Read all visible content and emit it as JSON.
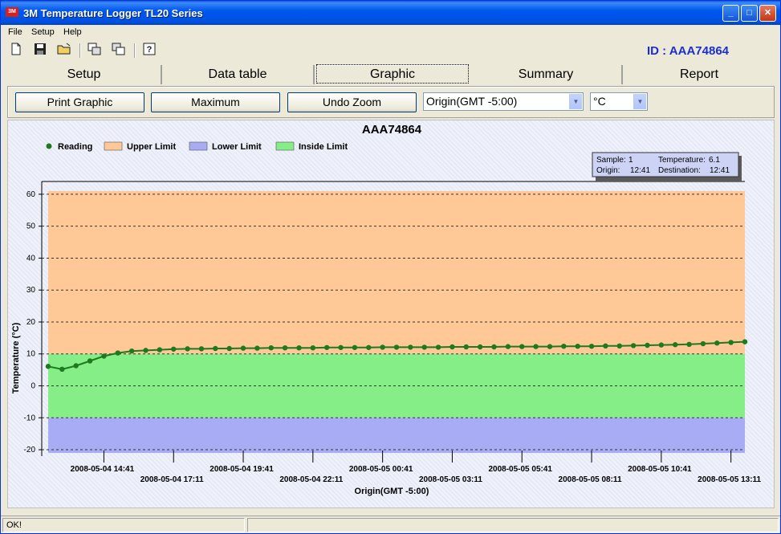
{
  "window": {
    "title": "3M Temperature Logger TL20 Series",
    "icon_text": "3M"
  },
  "menu": [
    "File",
    "Setup",
    "Help"
  ],
  "toolbar_icons": [
    "new-file-icon",
    "save-icon",
    "open-folder-icon",
    "copy-window-icon",
    "paste-window-icon",
    "help-icon"
  ],
  "device_id": "ID : AAA74864",
  "tabs": [
    "Setup",
    "Data table",
    "Graphic",
    "Summary",
    "Report"
  ],
  "active_tab": "Graphic",
  "controls": {
    "print_label": "Print Graphic",
    "maximum_label": "Maximum",
    "undo_zoom_label": "Undo Zoom",
    "timezone_value": "Origin(GMT -5:00)",
    "unit_value": "°C"
  },
  "tooltip": {
    "sample_label": "Sample:",
    "sample_value": "1",
    "temperature_label": "Temperature:",
    "temperature_value": "6.1",
    "origin_label": "Origin:",
    "origin_value": "12:41",
    "destination_label": "Destination:",
    "destination_value": "12:41"
  },
  "chart_data": {
    "type": "line",
    "title": "AAA74864",
    "ylabel": "Temperature (°C)",
    "xlabel": "Origin(GMT -5:00)",
    "ylim": [
      -22,
      64
    ],
    "yticks": [
      60,
      50,
      40,
      30,
      20,
      10,
      0,
      -10,
      -20
    ],
    "xticks": [
      "2008-05-04 14:41",
      "2008-05-04 17:11",
      "2008-05-04 19:41",
      "2008-05-04 22:11",
      "2008-05-05 00:41",
      "2008-05-05 03:11",
      "2008-05-05 05:41",
      "2008-05-05 08:11",
      "2008-05-05 10:41",
      "2008-05-05 13:11"
    ],
    "x_start": "2008-05-04 12:41",
    "x_end": "2008-05-05 13:41",
    "legend": [
      {
        "name": "Reading",
        "color": "#1e7a1e"
      },
      {
        "name": "Upper Limit",
        "color": "#ffc896"
      },
      {
        "name": "Lower Limit",
        "color": "#a8acf5"
      },
      {
        "name": "Inside Limit",
        "color": "#86ee86"
      }
    ],
    "limits": {
      "upper": 10,
      "lower": -10,
      "top": 61,
      "bottom": -21
    },
    "grid": true,
    "series": [
      {
        "name": "Reading",
        "color": "#1e7a1e",
        "x": [
          "2008-05-04 12:41",
          "2008-05-04 13:11",
          "2008-05-04 13:41",
          "2008-05-04 14:11",
          "2008-05-04 14:41",
          "2008-05-04 15:11",
          "2008-05-04 15:41",
          "2008-05-04 16:11",
          "2008-05-04 16:41",
          "2008-05-04 17:11",
          "2008-05-04 17:41",
          "2008-05-04 18:11",
          "2008-05-04 18:41",
          "2008-05-04 19:11",
          "2008-05-04 19:41",
          "2008-05-04 20:11",
          "2008-05-04 20:41",
          "2008-05-04 21:11",
          "2008-05-04 21:41",
          "2008-05-04 22:11",
          "2008-05-04 22:41",
          "2008-05-04 23:11",
          "2008-05-04 23:41",
          "2008-05-05 00:11",
          "2008-05-05 00:41",
          "2008-05-05 01:11",
          "2008-05-05 01:41",
          "2008-05-05 02:11",
          "2008-05-05 02:41",
          "2008-05-05 03:11",
          "2008-05-05 03:41",
          "2008-05-05 04:11",
          "2008-05-05 04:41",
          "2008-05-05 05:11",
          "2008-05-05 05:41",
          "2008-05-05 06:11",
          "2008-05-05 06:41",
          "2008-05-05 07:11",
          "2008-05-05 07:41",
          "2008-05-05 08:11",
          "2008-05-05 08:41",
          "2008-05-05 09:11",
          "2008-05-05 09:41",
          "2008-05-05 10:11",
          "2008-05-05 10:41",
          "2008-05-05 11:11",
          "2008-05-05 11:41",
          "2008-05-05 12:11",
          "2008-05-05 12:41",
          "2008-05-05 13:11",
          "2008-05-05 13:41"
        ],
        "values": [
          6.1,
          5.2,
          6.3,
          7.8,
          9.3,
          10.3,
          10.9,
          11.1,
          11.3,
          11.5,
          11.6,
          11.6,
          11.7,
          11.7,
          11.8,
          11.8,
          11.9,
          11.9,
          11.9,
          11.9,
          12.0,
          12.0,
          12.0,
          12.0,
          12.1,
          12.1,
          12.1,
          12.1,
          12.1,
          12.2,
          12.2,
          12.2,
          12.2,
          12.3,
          12.3,
          12.3,
          12.3,
          12.4,
          12.4,
          12.4,
          12.5,
          12.5,
          12.6,
          12.7,
          12.8,
          12.9,
          13.0,
          13.2,
          13.4,
          13.6,
          13.8
        ]
      }
    ]
  },
  "status": {
    "message": "OK!",
    "secondary": ""
  }
}
